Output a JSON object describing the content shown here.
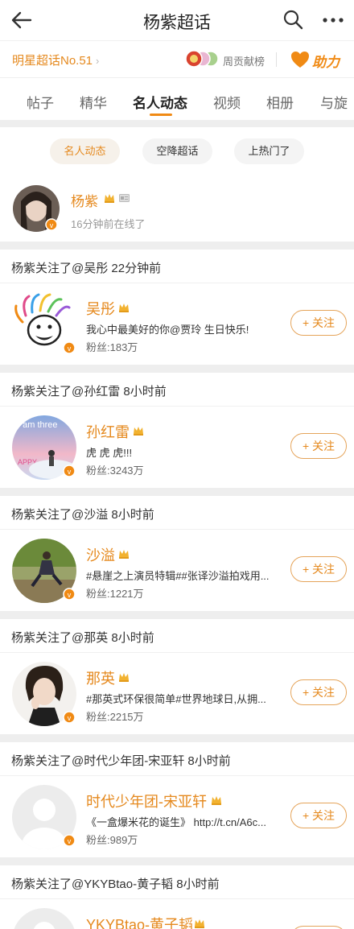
{
  "header": {
    "title": "杨紫超话",
    "back_icon": "back-arrow-icon",
    "search_icon": "search-icon",
    "more_icon": "more-dots-icon"
  },
  "rank_bar": {
    "rank_label": "明星超话No.51",
    "contribution_label": "周贡献榜",
    "boost_label": "助力",
    "accent_color": "#f08a14"
  },
  "tabs": [
    {
      "label": "帖子",
      "active": false
    },
    {
      "label": "精华",
      "active": false
    },
    {
      "label": "名人动态",
      "active": true
    },
    {
      "label": "视频",
      "active": false
    },
    {
      "label": "相册",
      "active": false
    },
    {
      "label": "与旋",
      "active": false
    }
  ],
  "filter_chips": [
    {
      "label": "名人动态",
      "active": true
    },
    {
      "label": "空降超话",
      "active": false
    },
    {
      "label": "上热门了",
      "active": false
    }
  ],
  "profile": {
    "name": "杨紫",
    "last_online": "16分钟前在线了"
  },
  "feed": [
    {
      "action": "杨紫关注了@吴彤 22分钟前",
      "name": "吴彤",
      "desc": "我心中最美好的你@贾玲 生日快乐!",
      "fans": "粉丝:183万",
      "follow_label": "+ 关注"
    },
    {
      "action": "杨紫关注了@孙红雷 8小时前",
      "name": "孙红雷",
      "desc": "虎 虎 虎!!!",
      "fans": "粉丝:3243万",
      "follow_label": "+ 关注"
    },
    {
      "action": "杨紫关注了@沙溢 8小时前",
      "name": "沙溢",
      "desc": "#悬崖之上演员特辑##张译沙溢拍戏用...",
      "fans": "粉丝:1221万",
      "follow_label": "+ 关注"
    },
    {
      "action": "杨紫关注了@那英 8小时前",
      "name": "那英",
      "desc": "#那英式环保很简单#世界地球日,从拥...",
      "fans": "粉丝:2215万",
      "follow_label": "+ 关注"
    },
    {
      "action": "杨紫关注了@时代少年团-宋亚轩 8小时前",
      "name": "时代少年团-宋亚轩",
      "desc": "《一盒爆米花的诞生》 http://t.cn/A6c...",
      "fans": "粉丝:989万",
      "follow_label": "+ 关注"
    },
    {
      "action": "杨紫关注了@YKYBtao-黄子韬 8小时前",
      "name": "YKYBtao-黄子韬",
      "desc": "",
      "fans": "",
      "follow_label": ""
    }
  ]
}
